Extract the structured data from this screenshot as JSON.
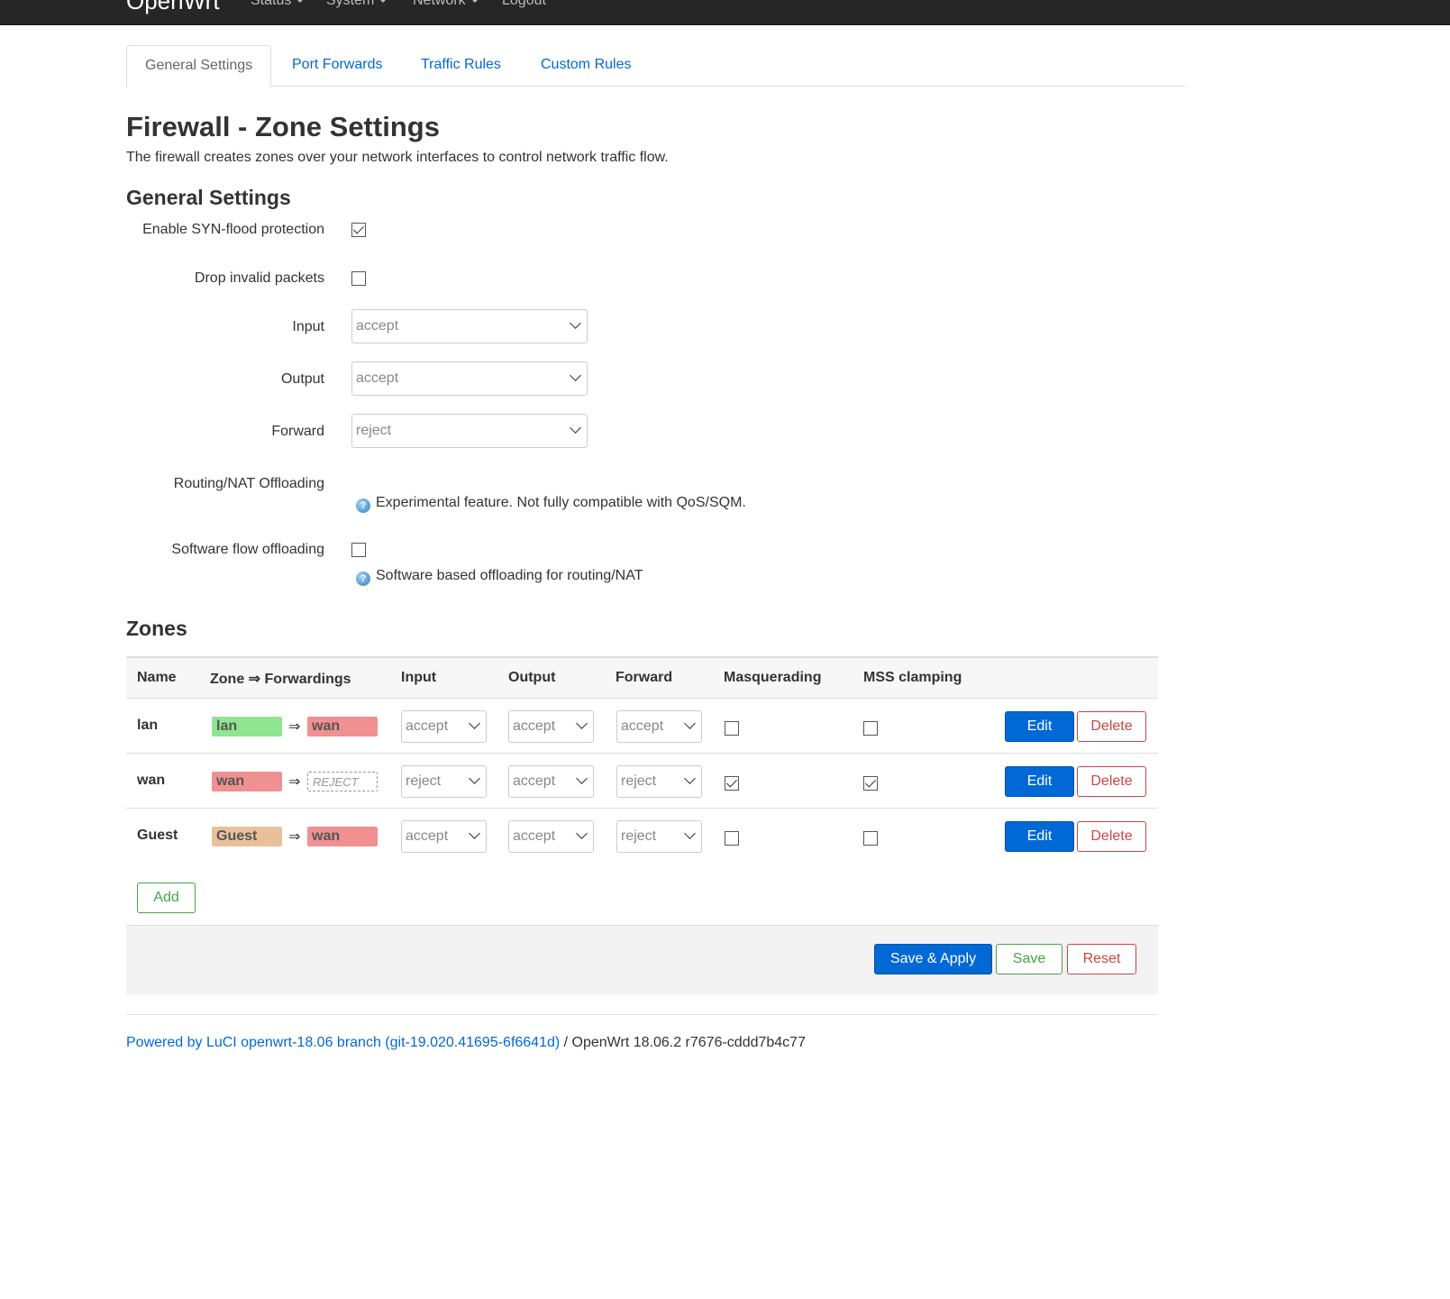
{
  "navbar": {
    "brand": "OpenWrt",
    "items": [
      "Status",
      "System",
      "Network",
      "Logout"
    ]
  },
  "tabs": [
    "General Settings",
    "Port Forwards",
    "Traffic Rules",
    "Custom Rules"
  ],
  "page": {
    "title": "Firewall - Zone Settings",
    "description": "The firewall creates zones over your network interfaces to control network traffic flow."
  },
  "general": {
    "heading": "General Settings",
    "syn_flood_label": "Enable SYN-flood protection",
    "syn_flood_checked": true,
    "drop_invalid_label": "Drop invalid packets",
    "drop_invalid_checked": false,
    "input_label": "Input",
    "input_value": "accept",
    "output_label": "Output",
    "output_value": "accept",
    "forward_label": "Forward",
    "forward_value": "reject",
    "offloading_label": "Routing/NAT Offloading",
    "offloading_help": "Experimental feature. Not fully compatible with QoS/SQM.",
    "sw_offload_label": "Software flow offloading",
    "sw_offload_checked": false,
    "sw_offload_help": "Software based offloading for routing/NAT"
  },
  "zones": {
    "heading": "Zones",
    "headers": {
      "name": "Name",
      "zone_fwd": "Zone ⇒ Forwardings",
      "input": "Input",
      "output": "Output",
      "forward": "Forward",
      "masq": "Masquerading",
      "mss": "MSS clamping"
    },
    "rows": [
      {
        "name": "lan",
        "zone": "lan",
        "zone_color": "#90e590",
        "fwd": "wan",
        "fwd_color": "#f09090",
        "input": "accept",
        "output": "accept",
        "forward": "accept",
        "masq": false,
        "mss": false
      },
      {
        "name": "wan",
        "zone": "wan",
        "zone_color": "#f09090",
        "fwd": "REJECT",
        "fwd_color": "",
        "input": "reject",
        "output": "accept",
        "forward": "reject",
        "masq": true,
        "mss": true
      },
      {
        "name": "Guest",
        "zone": "Guest",
        "zone_color": "#eac09a",
        "fwd": "wan",
        "fwd_color": "#f09090",
        "input": "accept",
        "output": "accept",
        "forward": "reject",
        "masq": false,
        "mss": false
      }
    ],
    "edit_label": "Edit",
    "delete_label": "Delete",
    "add_label": "Add"
  },
  "actions": {
    "save_apply": "Save & Apply",
    "save": "Save",
    "reset": "Reset"
  },
  "footer": {
    "link_text": "Powered by LuCI openwrt-18.06 branch (git-19.020.41695-6f6641d)",
    "version_text": " / OpenWrt 18.06.2 r7676-cddd7b4c77"
  },
  "colors": {
    "accent": "#0069d6",
    "danger": "#cc4444",
    "success": "#46a546"
  },
  "icons": [
    "help-icon",
    "caret-down-icon",
    "chevron-down-icon",
    "checkmark-icon"
  ]
}
